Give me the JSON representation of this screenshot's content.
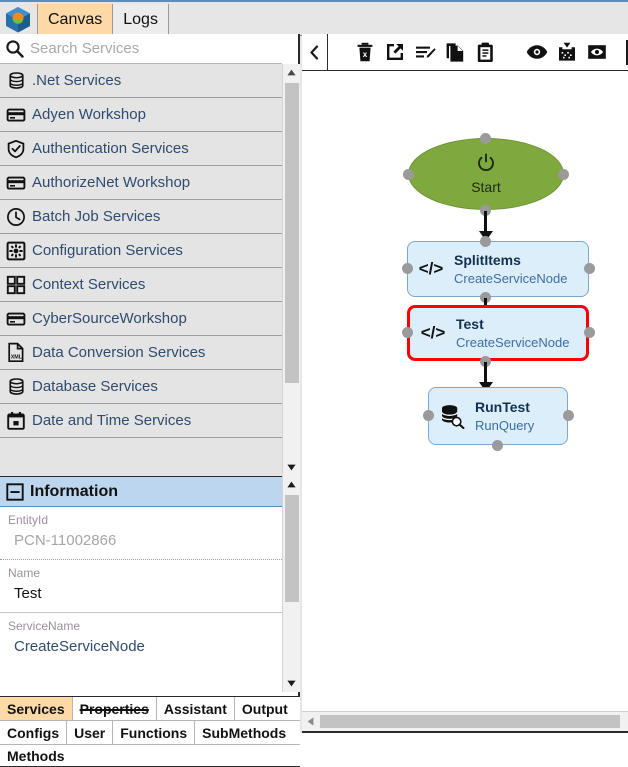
{
  "app": {
    "logo_icon": "cube-logo-icon",
    "tabs": [
      {
        "label": "Canvas",
        "active": true
      },
      {
        "label": "Logs",
        "active": false
      }
    ]
  },
  "sidebar": {
    "search": {
      "icon": "search-icon",
      "value": "",
      "placeholder": "Search Services"
    },
    "services": [
      {
        "label": ".Net Services",
        "icon": "database-icon"
      },
      {
        "label": "Adyen Workshop",
        "icon": "credit-card-icon"
      },
      {
        "label": "Authentication Services",
        "icon": "shield-check-icon"
      },
      {
        "label": "AuthorizeNet Workshop",
        "icon": "credit-card-icon"
      },
      {
        "label": "Batch Job Services",
        "icon": "clock-icon"
      },
      {
        "label": "Configuration Services",
        "icon": "gear-icon"
      },
      {
        "label": "Context Services",
        "icon": "grid-icon"
      },
      {
        "label": "CyberSourceWorkshop",
        "icon": "credit-card-icon"
      },
      {
        "label": "Data Conversion Services",
        "icon": "xml-file-icon"
      },
      {
        "label": "Database Services",
        "icon": "database-icon"
      },
      {
        "label": "Date and Time Services",
        "icon": "calendar-icon"
      }
    ]
  },
  "information": {
    "header": "Information",
    "collapse_icon": "minus-box-icon",
    "fields": [
      {
        "label": "EntityId",
        "value": "PCN-11002866",
        "style": "muted"
      },
      {
        "label": "Name",
        "value": "Test",
        "style": "normal"
      },
      {
        "label": "ServiceName",
        "value": "CreateServiceNode",
        "style": "blue"
      }
    ]
  },
  "bottom_tabs": {
    "row1": [
      {
        "label": "Services",
        "active": true,
        "struck": false
      },
      {
        "label": "Properties",
        "active": false,
        "struck": true
      },
      {
        "label": "Assistant",
        "active": false,
        "struck": false
      },
      {
        "label": "Output",
        "active": false,
        "struck": false
      }
    ],
    "row2": [
      {
        "label": "Configs",
        "active": false,
        "struck": false
      },
      {
        "label": "User",
        "active": false,
        "struck": false
      },
      {
        "label": "Functions",
        "active": false,
        "struck": false
      },
      {
        "label": "SubMethods",
        "active": false,
        "struck": false
      }
    ],
    "row3": [
      {
        "label": "Methods",
        "active": false,
        "struck": false
      }
    ]
  },
  "canvas_toolbar": {
    "collapse_icon": "chevron-left-icon",
    "buttons": [
      {
        "icon": "delete-trash-icon"
      },
      {
        "icon": "open-external-icon"
      },
      {
        "icon": "edit-list-icon"
      },
      {
        "icon": "copy-icon"
      },
      {
        "icon": "paste-clipboard-icon"
      },
      {
        "icon": "eye-icon"
      },
      {
        "icon": "import-download-icon"
      },
      {
        "icon": "eye-box-icon"
      }
    ]
  },
  "canvas": {
    "nodes": [
      {
        "id": "start",
        "title": "Start",
        "subtitle": "",
        "icon": "power-icon",
        "type": "start",
        "selected": false
      },
      {
        "id": "splititems",
        "title": "SplitItems",
        "subtitle": "CreateServiceNode",
        "icon": "code-icon",
        "type": "service",
        "selected": false
      },
      {
        "id": "test",
        "title": "Test",
        "subtitle": "CreateServiceNode",
        "icon": "code-icon",
        "type": "service",
        "selected": true
      },
      {
        "id": "runtest",
        "title": "RunTest",
        "subtitle": "RunQuery",
        "icon": "database-search-icon",
        "type": "query",
        "selected": false
      }
    ],
    "colors": {
      "start_fill": "#7fa93f",
      "node_fill": "#ddeefb",
      "node_border": "#7aa8cf",
      "selected_border": "#ff0000",
      "port": "#9a9a9a",
      "connector": "#111111"
    }
  }
}
